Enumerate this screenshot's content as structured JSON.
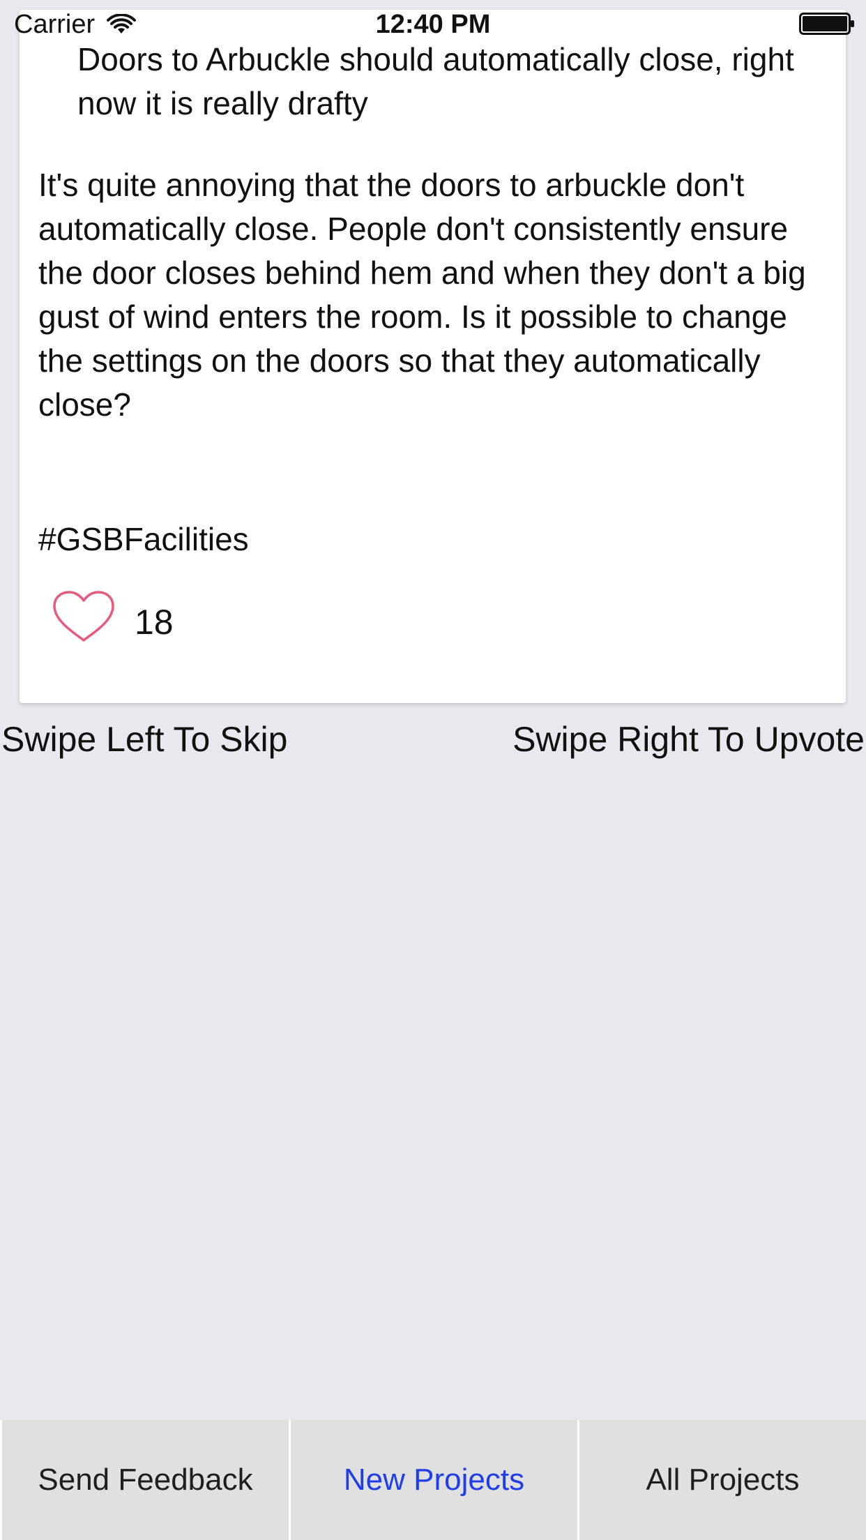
{
  "status_bar": {
    "carrier": "Carrier",
    "time": "12:40 PM",
    "wifi_icon": "wifi-icon",
    "battery_icon": "battery-icon"
  },
  "card": {
    "title": "Doors to Arbuckle should automatically close, right now it is really drafty",
    "body": "It's quite annoying that the doors to arbuckle don't automatically close. People don't consistently ensure the door closes behind hem and when they don't a big gust of wind enters the room. Is it possible to change the settings on the doors so that they automatically close?",
    "tag": "#GSBFacilities",
    "like_icon": "heart-outline-icon",
    "likes": "18",
    "heart_color": "#e85a7b"
  },
  "hints": {
    "left": "Swipe Left To Skip",
    "right": "Swipe Right To Upvote"
  },
  "tabs": [
    {
      "label": "Send Feedback",
      "active": false
    },
    {
      "label": "New Projects",
      "active": true
    },
    {
      "label": "All Projects",
      "active": false
    }
  ],
  "colors": {
    "background": "#e9e8ef",
    "tab_background": "#e0e0e0",
    "active_tab": "#1f3de8"
  }
}
